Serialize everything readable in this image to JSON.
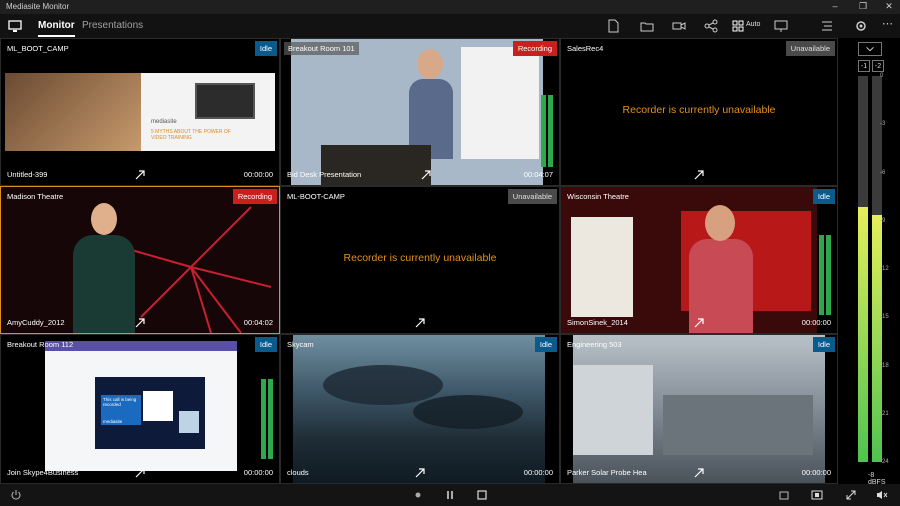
{
  "app": {
    "title": "Mediasite Monitor"
  },
  "nav": {
    "tab_monitor": "Monitor",
    "tab_presentations": "Presentations",
    "layout_label": "Auto"
  },
  "tiles": [
    {
      "name": "ML_BOOT_CAMP",
      "status": "Idle",
      "title": "Untitled-399",
      "time": "00:00:00"
    },
    {
      "name": "Breakout Room 101",
      "status": "Recording",
      "title": "Bid Desk Presentation",
      "time": "00:04:07"
    },
    {
      "name": "SalesRec4",
      "status": "Unavailable",
      "message": "Recorder is currently unavailable"
    },
    {
      "name": "Madison Theatre",
      "status": "Recording",
      "title": "AmyCuddy_2012",
      "time": "00:04:02"
    },
    {
      "name": "ML-BOOT-CAMP",
      "status": "Unavailable",
      "message": "Recorder is currently unavailable"
    },
    {
      "name": "Wisconsin Theatre",
      "status": "Idle",
      "title": "SimonSinek_2014",
      "time": "00:00:00"
    },
    {
      "name": "Breakout Room 112",
      "status": "Idle",
      "title": "Join Skype4Business",
      "time": "00:00:00"
    },
    {
      "name": "Skycam",
      "status": "Idle",
      "title": "clouds",
      "time": "00:00:00"
    },
    {
      "name": "Engineering 503",
      "status": "Idle",
      "title": "Parker Solar Probe Hea",
      "time": "00:00:00"
    }
  ],
  "slide": {
    "brand": "mediasite",
    "text": "5 MYTHS ABOUT THE POWER OF VIDEO TRAINING"
  },
  "skype": {
    "title": "This call is being recorded",
    "brand": "mediasite"
  },
  "meter": {
    "channels": [
      "-1",
      "-2"
    ],
    "ticks": [
      "0",
      "-3",
      "-6",
      "-9",
      "-12",
      "-15",
      "-18",
      "-21",
      "-24"
    ],
    "level_left": 0.66,
    "level_right": 0.64,
    "unit": "-8 dBFS"
  },
  "colors": {
    "idle": "#0b5a8c",
    "recording": "#c81f1f",
    "unavailable": "#4a4a4a",
    "accent": "#e3901e"
  }
}
